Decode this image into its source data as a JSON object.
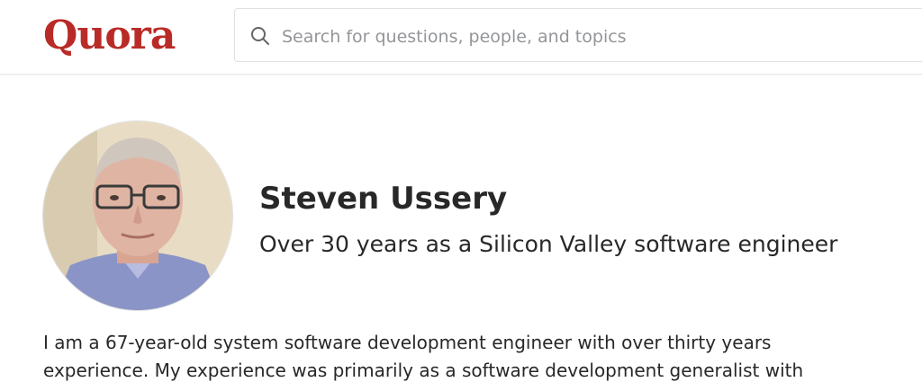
{
  "header": {
    "logo_text": "Quora",
    "search": {
      "placeholder": "Search for questions, people, and topics",
      "value": ""
    }
  },
  "profile": {
    "name": "Steven Ussery",
    "credential": "Over 30 years as a Silicon Valley software engineer",
    "bio_lines": [
      "I am a 67-year-old system software development engineer with over thirty years",
      "experience. My experience was primarily as a software development generalist with"
    ]
  },
  "colors": {
    "brand": "#b92b27",
    "text": "#282829",
    "placeholder": "#939598",
    "border": "#dee0e1"
  },
  "icons": {
    "search": "search-icon"
  }
}
